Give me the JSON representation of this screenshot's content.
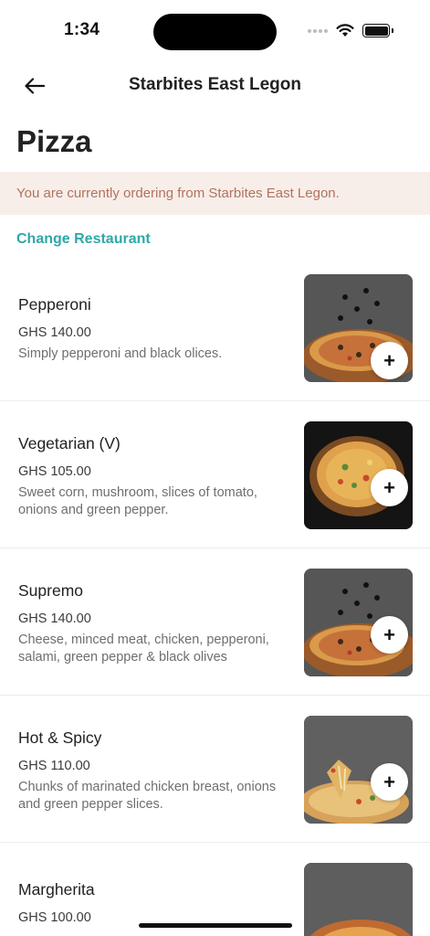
{
  "status_bar": {
    "time": "1:34"
  },
  "nav": {
    "title": "Starbites East Legon"
  },
  "category": {
    "title": "Pizza"
  },
  "notice": {
    "text": "You are currently ordering from Starbites East Legon."
  },
  "change_restaurant": {
    "label": "Change Restaurant"
  },
  "items": [
    {
      "name": "Pepperoni",
      "price": "GHS 140.00",
      "description": "Simply pepperoni and black olices."
    },
    {
      "name": "Vegetarian (V)",
      "price": "GHS 105.00",
      "description": "Sweet corn, mushroom, slices of tomato, onions and green pepper."
    },
    {
      "name": "Supremo",
      "price": "GHS 140.00",
      "description": "Cheese, minced meat, chicken, pepperoni, salami, green pepper & black olives"
    },
    {
      "name": "Hot & Spicy",
      "price": "GHS 110.00",
      "description": "Chunks of marinated chicken breast, onions and green pepper slices."
    },
    {
      "name": "Margherita",
      "price": "GHS 100.00",
      "description": ""
    }
  ],
  "add_button": {
    "symbol": "+"
  },
  "icons": {
    "back": "arrow-left-icon",
    "wifi": "wifi-icon",
    "battery": "battery-icon",
    "signal": "signal-icon",
    "add": "plus-icon"
  },
  "colors": {
    "accent": "#2fa8a8",
    "notice_bg": "#f8eee9",
    "notice_text": "#b0735e"
  }
}
